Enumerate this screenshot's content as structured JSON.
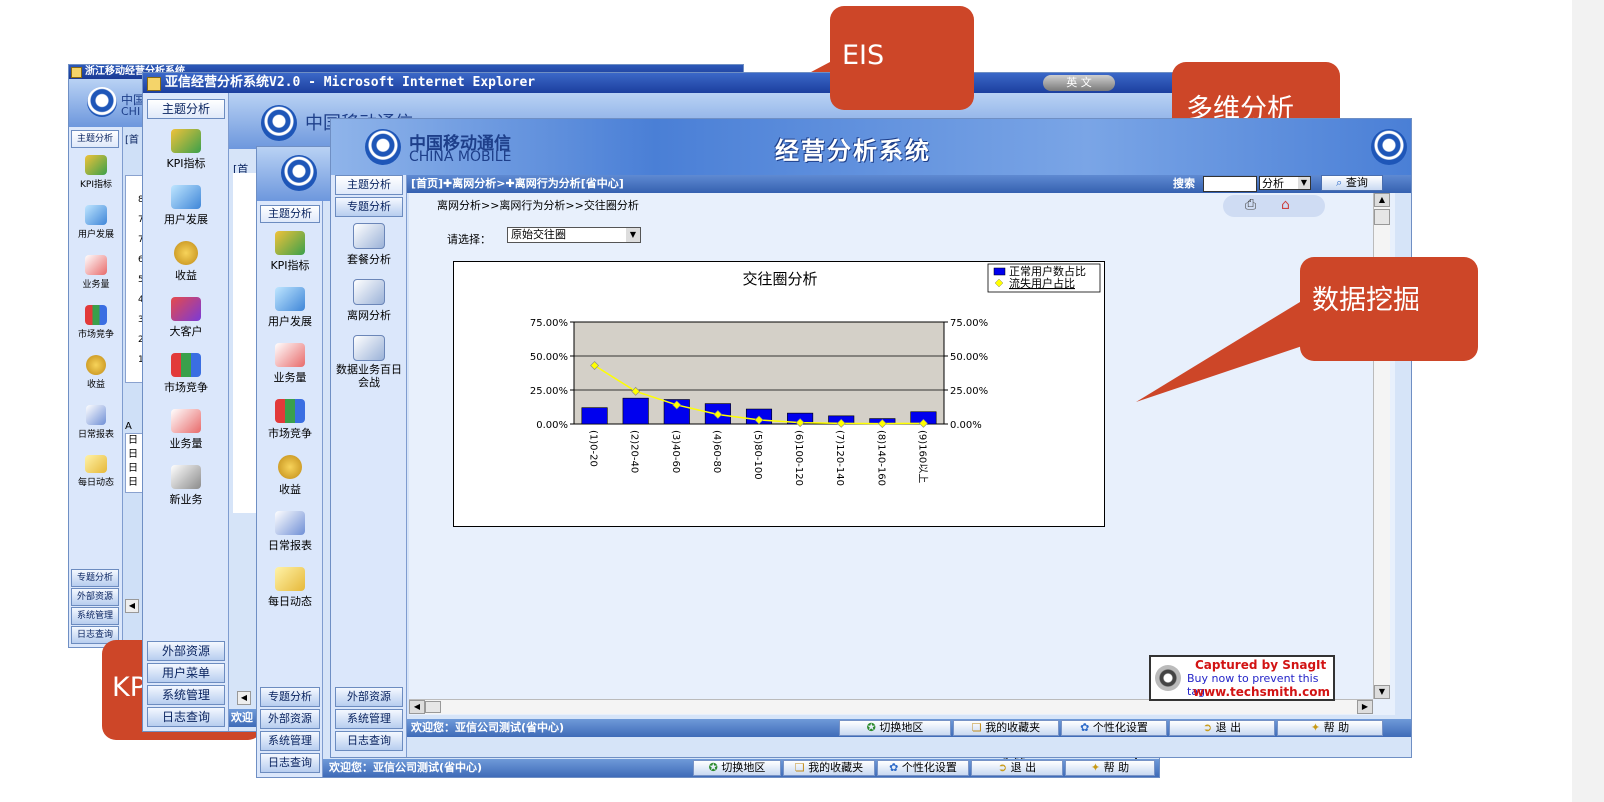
{
  "callouts": {
    "eis": "EIS",
    "multidim": "多维分析",
    "datamining": "数据挖掘",
    "kpi": "KPI"
  },
  "win1": {
    "title": "浙江移动经营分析系统",
    "logo_cn": "中国",
    "logo_en": "CHI",
    "nav_top": "主题分析",
    "crumb_fragment": "[首",
    "icons": [
      "KPI指标",
      "用户发展",
      "业务量",
      "市场竞争",
      "收益",
      "日常报表",
      "每日动态"
    ],
    "nav_bottom": [
      "专题分析",
      "外部资源",
      "系统管理",
      "日志查询"
    ],
    "list_letter": "A",
    "list_items": [
      "日",
      "日",
      "日",
      "日"
    ],
    "left_numbers": [
      "8",
      "7",
      "7",
      "6",
      "5",
      "4",
      "3",
      "2",
      "1"
    ]
  },
  "win2": {
    "title": "亚信经营分析系统V2.0 - Microsoft Internet Explorer",
    "lang_button": "英 文",
    "logo_text": "中国移动通信",
    "nav_top": "主题分析",
    "crumb_fragment": "[首",
    "icons": [
      "KPI指标",
      "用户发展",
      "收益",
      "大客户",
      "市场竞争",
      "业务量",
      "新业务"
    ],
    "nav_bottom": [
      "外部资源",
      "用户菜单",
      "系统管理",
      "日志查询"
    ],
    "status_fragment": "欢迎"
  },
  "win3": {
    "nav_top": "主题分析",
    "icons": [
      "KPI指标",
      "用户发展",
      "业务量",
      "市场竞争",
      "收益",
      "日常报表",
      "每日动态"
    ],
    "nav_bottom": [
      "专题分析",
      "外部资源",
      "系统管理",
      "日志查询"
    ],
    "status_text": "欢迎您：亚信公司测试(省中心)",
    "size_readout": "2x56",
    "status_buttons": [
      "切换地区",
      "我的收藏夹",
      "个性化设置",
      "退 出",
      "帮 助"
    ]
  },
  "win4": {
    "logo_cn": "中国移动通信",
    "logo_en": "CHINA MOBILE",
    "system_title": "经营分析系统",
    "breadcrumb_nav": "[首页]✚离网分析>✚离网行为分析[省中心]",
    "search_label": "搜索",
    "search_value": "",
    "search_select": "分析",
    "query_button": "查询",
    "nav_top": [
      "主题分析",
      "专题分析"
    ],
    "icons": [
      "套餐分析",
      "离网分析",
      "数据业务百日会战"
    ],
    "nav_bottom": [
      "外部资源",
      "系统管理",
      "日志查询"
    ],
    "path": "离网分析>>离网行为分析>>交往圈分析",
    "select_label": "请选择：",
    "select_value": "原始交往圈",
    "status_text": "欢迎您：亚信公司测试(省中心)",
    "status_buttons": [
      "切换地区",
      "我的收藏夹",
      "个性化设置",
      "退 出",
      "帮 助"
    ]
  },
  "snagit": {
    "line1": "Captured by SnagIt",
    "line2": "Buy now to prevent this tag",
    "line3": "www.techsmith.com"
  },
  "colors": {
    "callout": "#cd4628",
    "bar": "#0000ee",
    "line": "#ffff00",
    "plot_bg": "#d4d0c8"
  },
  "chart_data": {
    "type": "bar",
    "title": "交往圈分析",
    "categories": [
      "(1)0-20",
      "(2)20-40",
      "(3)40-60",
      "(4)60-80",
      "(5)80-100",
      "(6)100-120",
      "(7)120-140",
      "(8)140-160",
      "(9)160以上"
    ],
    "series": [
      {
        "name": "正常用户数占比",
        "type": "bar",
        "values": [
          12,
          19,
          18,
          15,
          11,
          8,
          6,
          4,
          9
        ]
      },
      {
        "name": "流失用户占比",
        "type": "line",
        "values": [
          43,
          24,
          14,
          7,
          3,
          1,
          0.5,
          0.3,
          0.5
        ]
      }
    ],
    "ylim": [
      0,
      75
    ],
    "yticks": [
      "0.00%",
      "25.00%",
      "50.00%",
      "75.00%"
    ],
    "grid": true,
    "legend": "top-right"
  }
}
